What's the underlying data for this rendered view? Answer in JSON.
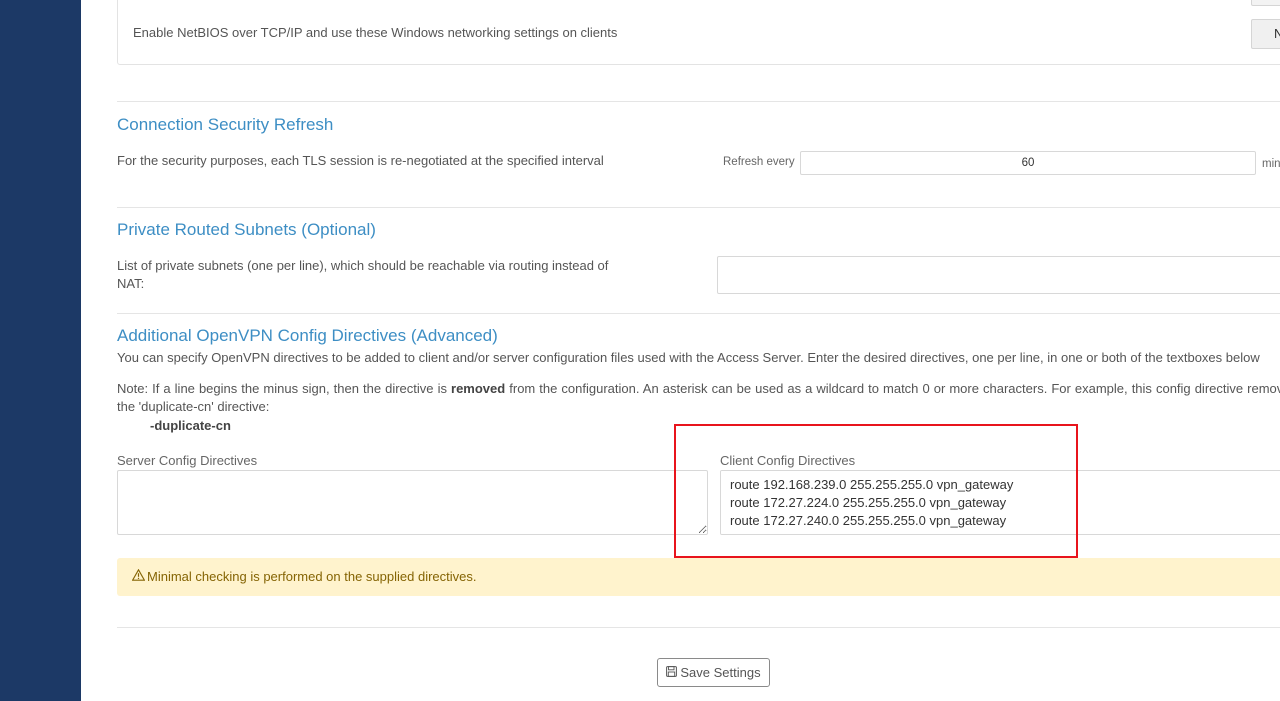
{
  "netbios": {
    "label": "Enable NetBIOS over TCP/IP and use these Windows networking settings on clients",
    "toggle_text": "N"
  },
  "security_refresh": {
    "title": "Connection Security Refresh",
    "description": "For the security purposes, each TLS session is re-negotiated at the specified interval",
    "refresh_label": "Refresh every",
    "refresh_value": "60",
    "unit": "min"
  },
  "subnets": {
    "title": "Private Routed Subnets (Optional)",
    "description": "List of private subnets (one per line), which should be reachable via routing instead of NAT:",
    "value": ""
  },
  "directives": {
    "title": "Additional OpenVPN Config Directives (Advanced)",
    "intro": "You can specify OpenVPN directives to be added to client and/or server configuration files used with the Access Server. Enter the desired directives, one per line, in one or both of the textboxes below",
    "note_pre": "Note: If a line begins the minus sign, then the directive is ",
    "note_bold": "removed",
    "note_post": " from the configuration. An asterisk can be used as a wildcard to match 0 or more characters. For example, this config directive removes the 'duplicate-cn' directive:",
    "example": "-duplicate-cn",
    "server_label": "Server Config Directives",
    "server_value": "",
    "client_label": "Client Config Directives",
    "client_value": "route 192.168.239.0 255.255.255.0 vpn_gateway\nroute 172.27.224.0 255.255.255.0 vpn_gateway\nroute 172.27.240.0 255.255.255.0 vpn_gateway"
  },
  "warning": {
    "icon": "warning-triangle-icon",
    "text": "Minimal checking is performed on the supplied directives."
  },
  "save_button": {
    "icon": "floppy-disk-icon",
    "label": "Save Settings"
  },
  "colors": {
    "sidebar": "#1c3966",
    "section_title": "#3d8ec4",
    "warning_bg": "#fff3cd",
    "warning_text": "#856404",
    "highlight_box": "#e8141c"
  }
}
